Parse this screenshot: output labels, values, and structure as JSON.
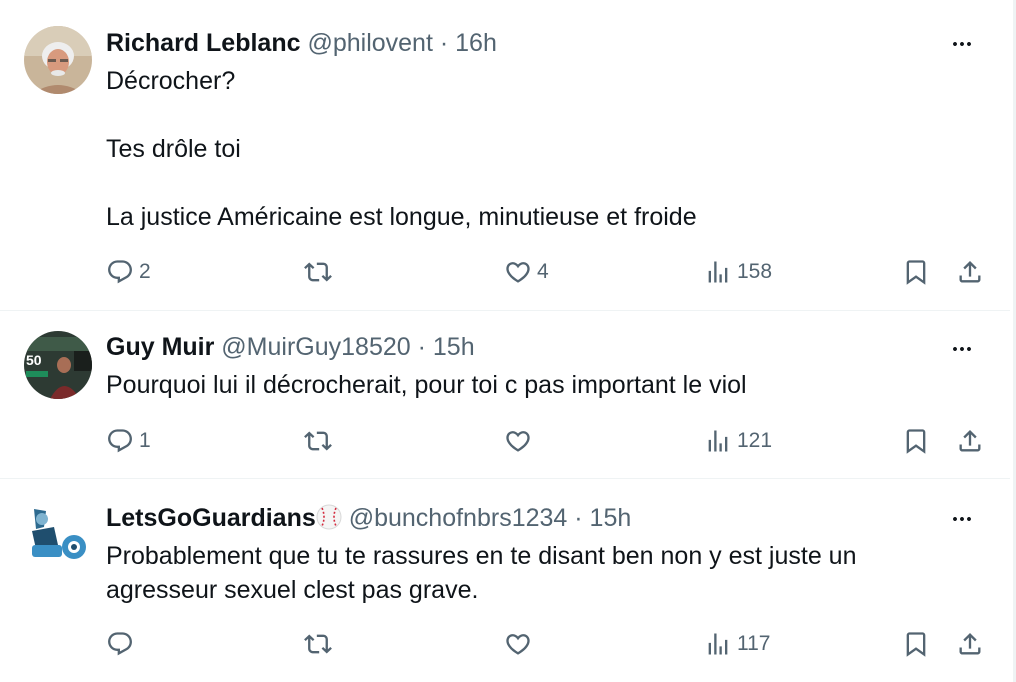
{
  "tweets": [
    {
      "name": "Richard Leblanc",
      "handle": "@philovent",
      "time": "16h",
      "paragraphs": [
        "Décrocher?",
        "Tes drôle toi",
        "La justice Américaine est longue, minutieuse et froide"
      ],
      "replies": "2",
      "retweets": "",
      "likes": "4",
      "views": "158",
      "avatar": "portrait-photo"
    },
    {
      "name": "Guy Muir",
      "handle": "@MuirGuy18520",
      "time": "15h",
      "paragraphs": [
        "Pourquoi lui il décrocherait, pour toi c pas important le viol"
      ],
      "replies": "1",
      "retweets": "",
      "likes": "",
      "views": "121",
      "avatar": "event-photo"
    },
    {
      "name": "LetsGoGuardians",
      "name_emoji": "⚾",
      "handle": "@bunchofnbrs1234",
      "time": "15h",
      "paragraphs": [
        "Probablement que tu te rassures en te disant ben non y est juste un agresseur sexuel clest pas grave."
      ],
      "replies": "",
      "retweets": "",
      "likes": "",
      "views": "117",
      "avatar": "guardians-logo"
    }
  ],
  "separator": "·",
  "colors": {
    "text": "#0f1419",
    "meta": "#536471",
    "border": "#eff3f4",
    "baseball_red": "#d3293d"
  }
}
